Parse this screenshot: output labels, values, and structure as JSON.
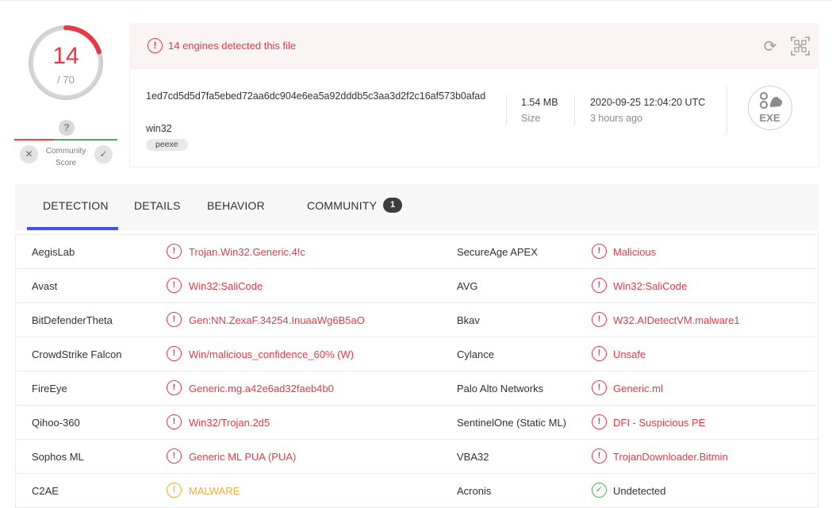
{
  "score": {
    "detected": "14",
    "total": "/ 70",
    "fraction": 0.2
  },
  "community": {
    "unknown_icon": "?",
    "label_line1": "Community",
    "label_line2": "Score"
  },
  "alert": {
    "text": "14 engines detected this file"
  },
  "file": {
    "hash": "1ed7cd5d5d7fa5ebed72aa6dc904e6ea5a92dddb5c3aa3d2f2c16af573b0afad",
    "type": "win32",
    "tag": "peexe",
    "size_value": "1.54 MB",
    "size_label": "Size",
    "date_value": "2020-09-25 12:04:20 UTC",
    "date_label": "3 hours ago",
    "type_icon_text": "EXE"
  },
  "tabs": {
    "detection": "DETECTION",
    "details": "DETAILS",
    "behavior": "BEHAVIOR",
    "community": "COMMUNITY",
    "community_count": "1"
  },
  "colors": {
    "malicious": "#e63946",
    "suspicious": "#f4a93a",
    "clean": "#4caf50",
    "accent": "#3f51f0"
  },
  "detections": [
    {
      "left_engine": "AegisLab",
      "left_result": "Trojan.Win32.Generic.4!c",
      "left_status": "malicious",
      "right_engine": "SecureAge APEX",
      "right_result": "Malicious",
      "right_status": "malicious"
    },
    {
      "left_engine": "Avast",
      "left_result": "Win32:SaliCode",
      "left_status": "malicious",
      "right_engine": "AVG",
      "right_result": "Win32:SaliCode",
      "right_status": "malicious"
    },
    {
      "left_engine": "BitDefenderTheta",
      "left_result": "Gen:NN.ZexaF.34254.InuaaWg6B5aO",
      "left_status": "malicious",
      "right_engine": "Bkav",
      "right_result": "W32.AIDetectVM.malware1",
      "right_status": "malicious"
    },
    {
      "left_engine": "CrowdStrike Falcon",
      "left_result": "Win/malicious_confidence_60% (W)",
      "left_status": "malicious",
      "right_engine": "Cylance",
      "right_result": "Unsafe",
      "right_status": "malicious"
    },
    {
      "left_engine": "FireEye",
      "left_result": "Generic.mg.a42e6ad32faeb4b0",
      "left_status": "malicious",
      "right_engine": "Palo Alto Networks",
      "right_result": "Generic.ml",
      "right_status": "malicious"
    },
    {
      "left_engine": "Qihoo-360",
      "left_result": "Win32/Trojan.2d5",
      "left_status": "malicious",
      "right_engine": "SentinelOne (Static ML)",
      "right_result": "DFI - Suspicious PE",
      "right_status": "malicious"
    },
    {
      "left_engine": "Sophos ML",
      "left_result": "Generic ML PUA (PUA)",
      "left_status": "malicious",
      "right_engine": "VBA32",
      "right_result": "TrojanDownloader.Bitmin",
      "right_status": "malicious"
    },
    {
      "left_engine": "C2AE",
      "left_result": "MALWARE",
      "left_status": "suspicious",
      "right_engine": "Acronis",
      "right_result": "Undetected",
      "right_status": "clean"
    }
  ]
}
